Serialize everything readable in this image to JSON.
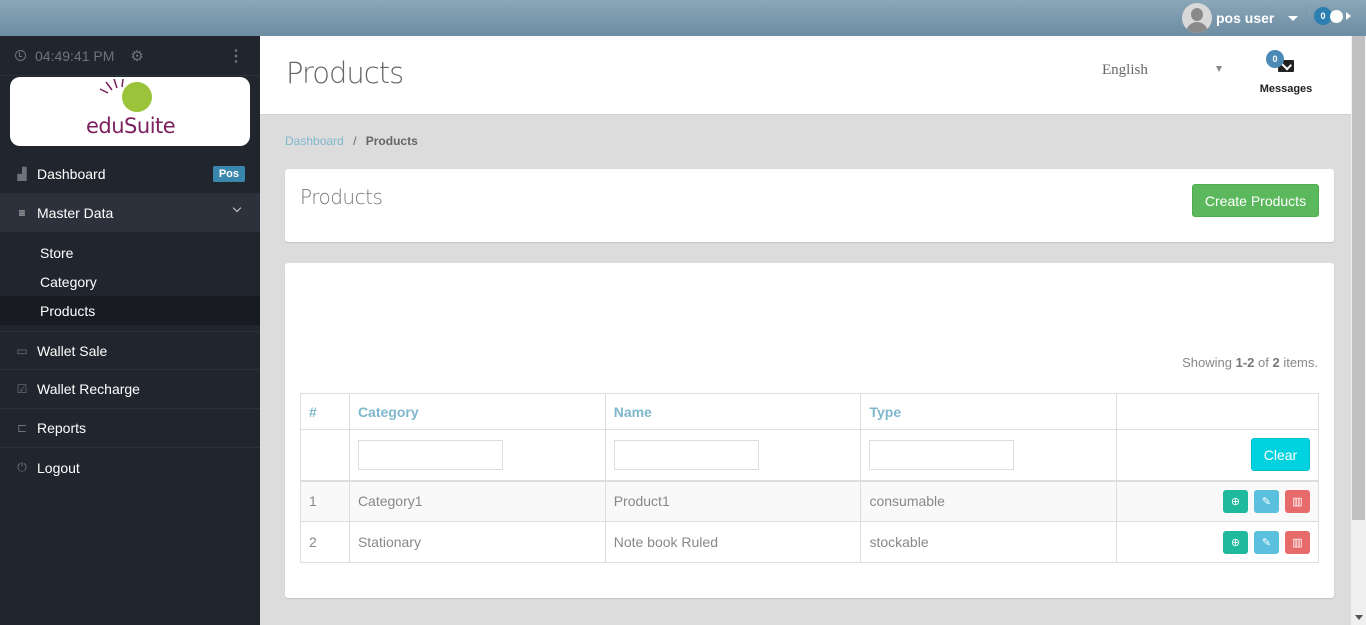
{
  "topbar": {
    "user_name": "pos user",
    "notification_count": "0"
  },
  "sidebar": {
    "time": "04:49:41 PM",
    "logo_text": "eduSuite",
    "items": [
      {
        "label": "Dashboard",
        "icon": "area-chart-icon",
        "badge": "Pos"
      },
      {
        "label": "Master Data",
        "icon": "database-icon",
        "expanded": true,
        "children": [
          {
            "label": "Store"
          },
          {
            "label": "Category"
          },
          {
            "label": "Products",
            "active": true
          }
        ]
      },
      {
        "label": "Wallet Sale",
        "icon": "money-icon"
      },
      {
        "label": "Wallet Recharge",
        "icon": "check-square-icon"
      },
      {
        "label": "Reports",
        "icon": "folder-open-icon"
      },
      {
        "label": "Logout",
        "icon": "power-icon"
      }
    ]
  },
  "header": {
    "title": "Products",
    "language": "English",
    "messages_label": "Messages",
    "messages_count": "0"
  },
  "breadcrumb": {
    "home": "Dashboard",
    "separator": "/",
    "current": "Products"
  },
  "panel": {
    "title": "Products",
    "create_button": "Create Products"
  },
  "grid": {
    "summary_prefix": "Showing ",
    "summary_range": "1-2",
    "summary_mid": " of ",
    "summary_total": "2",
    "summary_suffix": " items.",
    "columns": [
      "#",
      "Category",
      "Name",
      "Type",
      ""
    ],
    "filters": {
      "category": "",
      "name": "",
      "type": ""
    },
    "clear_button": "Clear",
    "rows": [
      {
        "index": "1",
        "category": "Category1",
        "name": "Product1",
        "type": "consumable"
      },
      {
        "index": "2",
        "category": "Stationary",
        "name": "Note book Ruled",
        "type": "stockable"
      }
    ],
    "action_icons": [
      "zoom-in-icon",
      "edit-icon",
      "trash-icon"
    ]
  },
  "colors": {
    "topbar": "#6d8da3",
    "sidebar": "#21252e",
    "create_button": "#5cb85c",
    "clear_button": "#00d2e0",
    "view_button": "#1fb99d",
    "edit_button": "#5bc0de",
    "delete_button": "#e86b6b",
    "link": "#7fb7cc"
  }
}
